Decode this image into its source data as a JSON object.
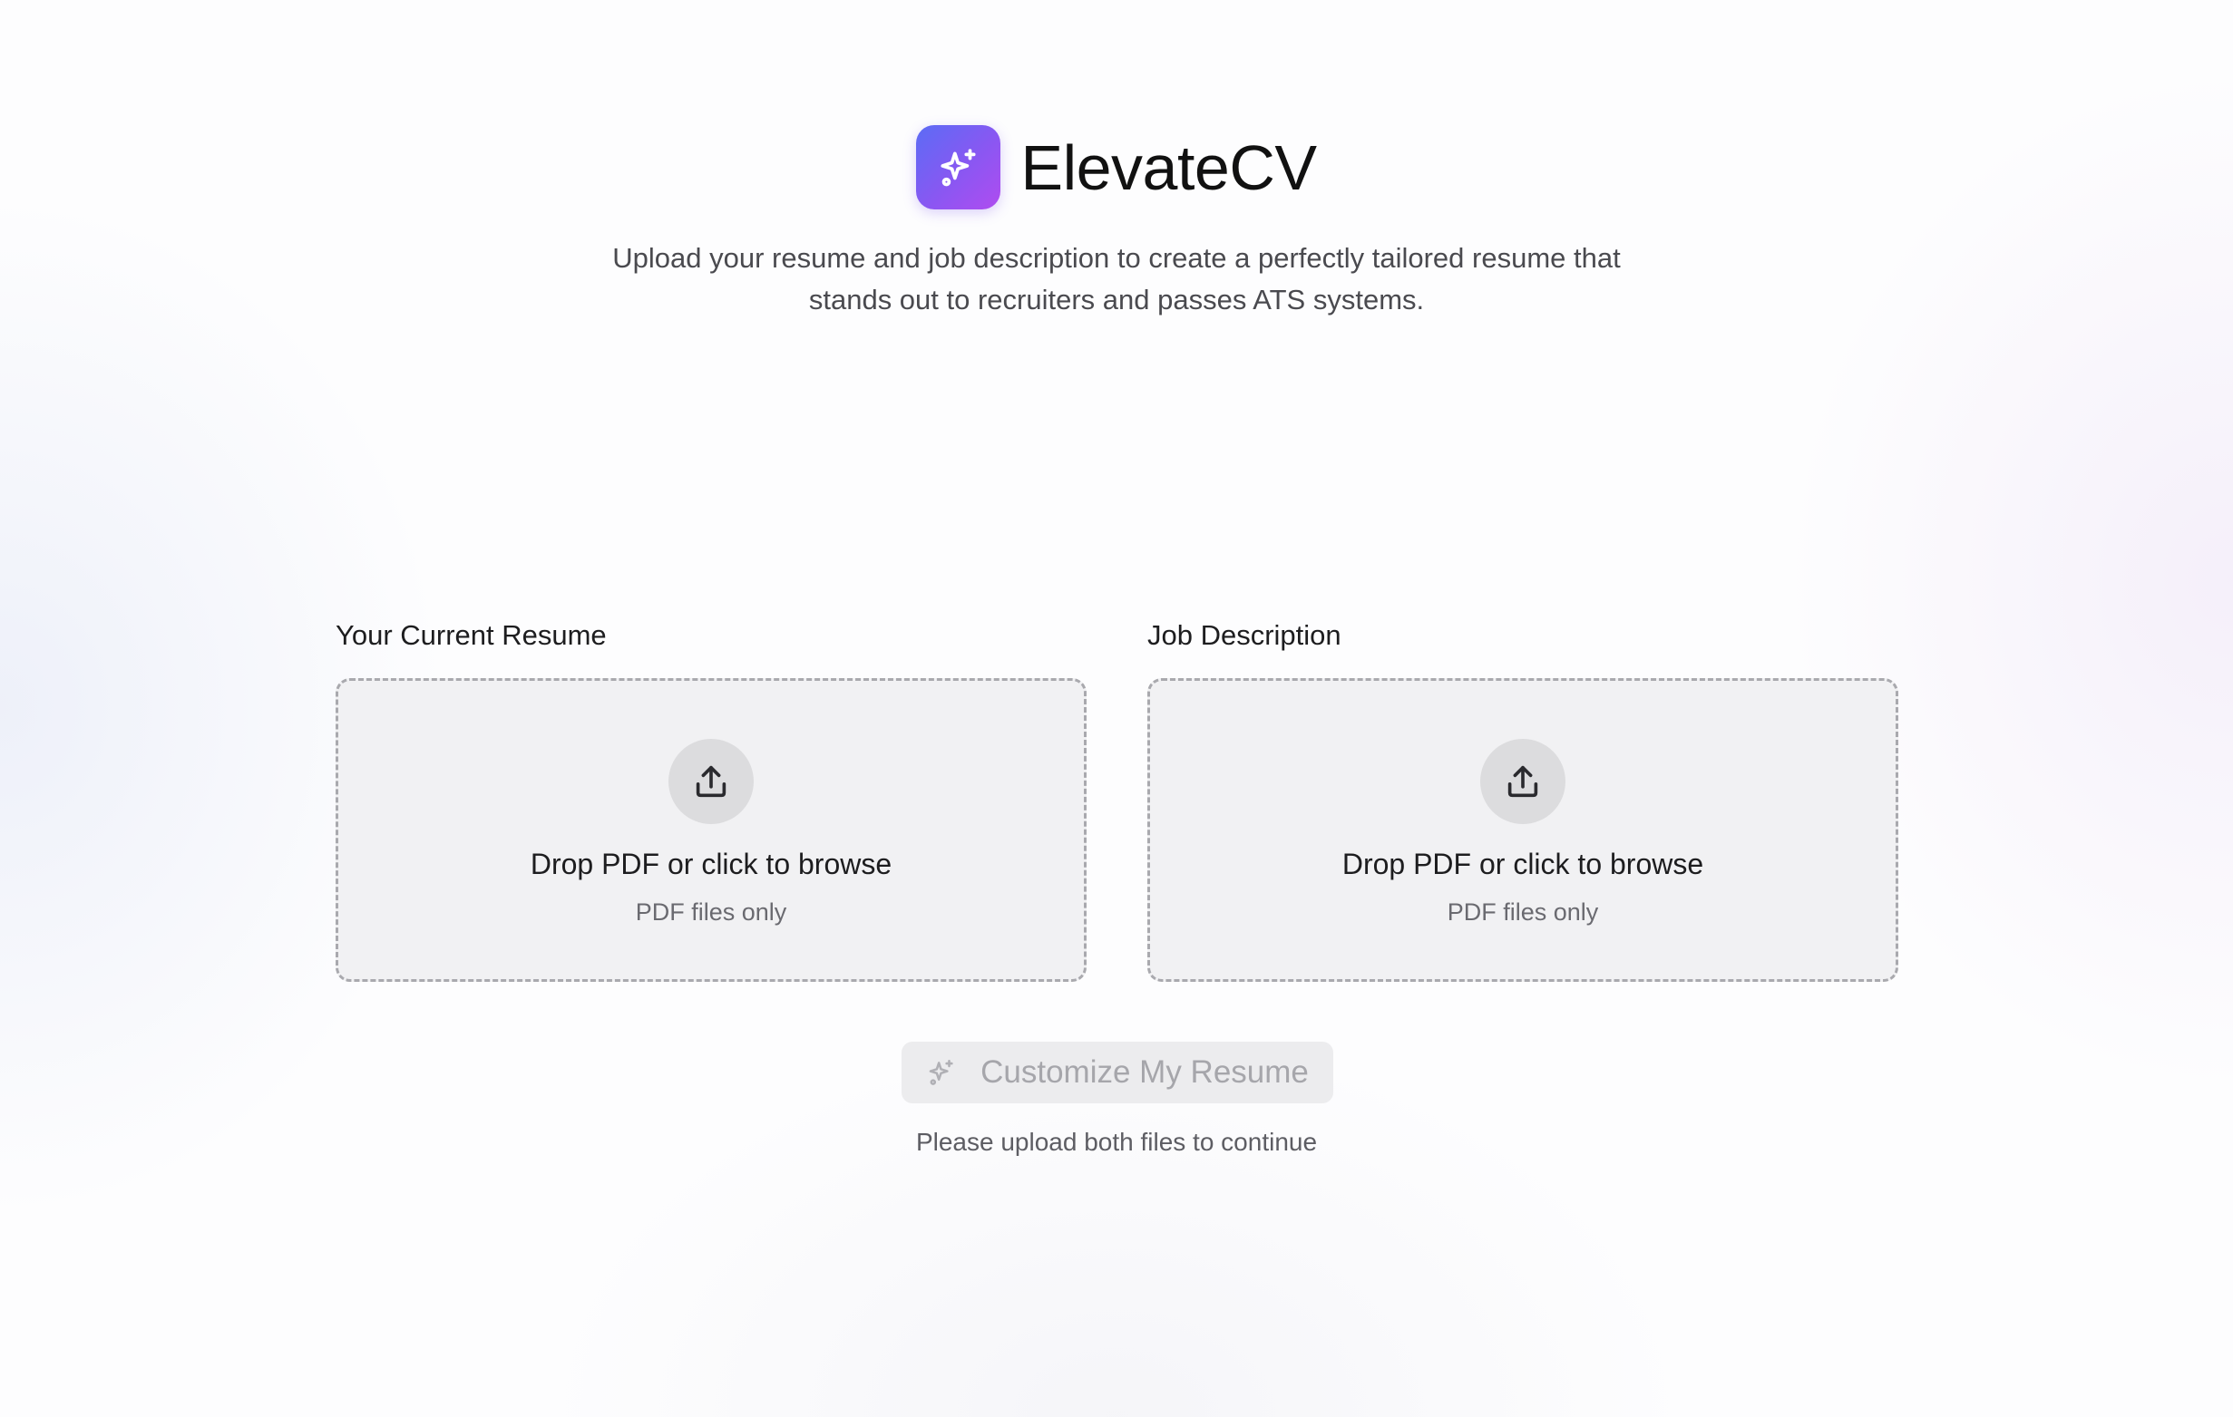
{
  "brand": {
    "name": "ElevateCV",
    "logo_icon": "sparkles-icon",
    "logo_gradient": [
      "#5b6cf5",
      "#b04cf0"
    ]
  },
  "header": {
    "tagline_line1": "Upload your resume and job description to create a perfectly tailored resume that",
    "tagline_line2": "stands out to recruiters and passes ATS systems."
  },
  "uploads": [
    {
      "label": "Your Current Resume",
      "icon": "upload-icon",
      "title": "Drop PDF or click to browse",
      "subtitle": "PDF files only"
    },
    {
      "label": "Job Description",
      "icon": "upload-icon",
      "title": "Drop PDF or click to browse",
      "subtitle": "PDF files only"
    }
  ],
  "action": {
    "button_label": "Customize My Resume",
    "button_icon": "sparkles-icon",
    "disabled": true,
    "hint": "Please upload both files to continue"
  }
}
